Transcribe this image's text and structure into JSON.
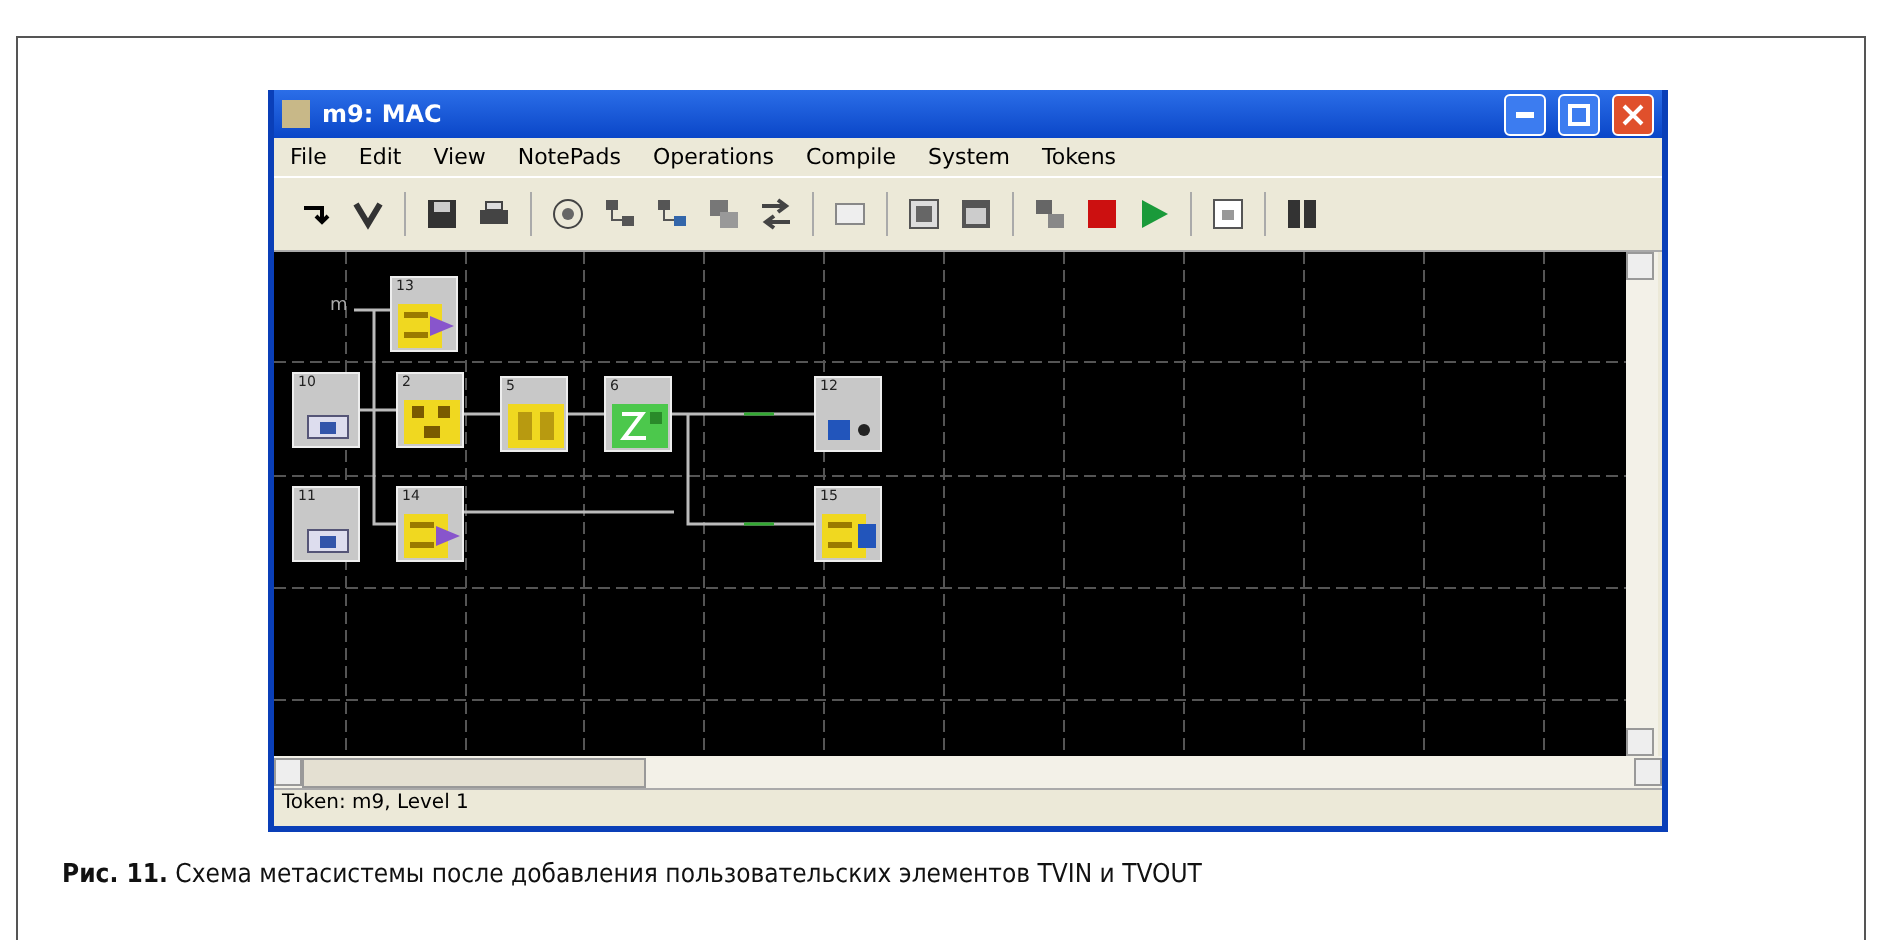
{
  "window": {
    "title": "m9: MAC"
  },
  "menu": [
    "File",
    "Edit",
    "View",
    "NotePads",
    "Operations",
    "Compile",
    "System",
    "Tokens"
  ],
  "canvas": {
    "input_label": "m",
    "nodes": [
      {
        "label": "13",
        "kind": "process"
      },
      {
        "label": "10",
        "kind": "input"
      },
      {
        "label": "2",
        "kind": "splitter"
      },
      {
        "label": "5",
        "kind": "filter"
      },
      {
        "label": "6",
        "kind": "display"
      },
      {
        "label": "12",
        "kind": "output"
      },
      {
        "label": "11",
        "kind": "input"
      },
      {
        "label": "14",
        "kind": "process"
      },
      {
        "label": "15",
        "kind": "process_out"
      }
    ]
  },
  "status_bar": "Token: m9, Level 1",
  "caption": {
    "text": "**Рис. 11.** Схема метасистемы после добавления пользовательских элементов TVIN и TVOUT"
  }
}
